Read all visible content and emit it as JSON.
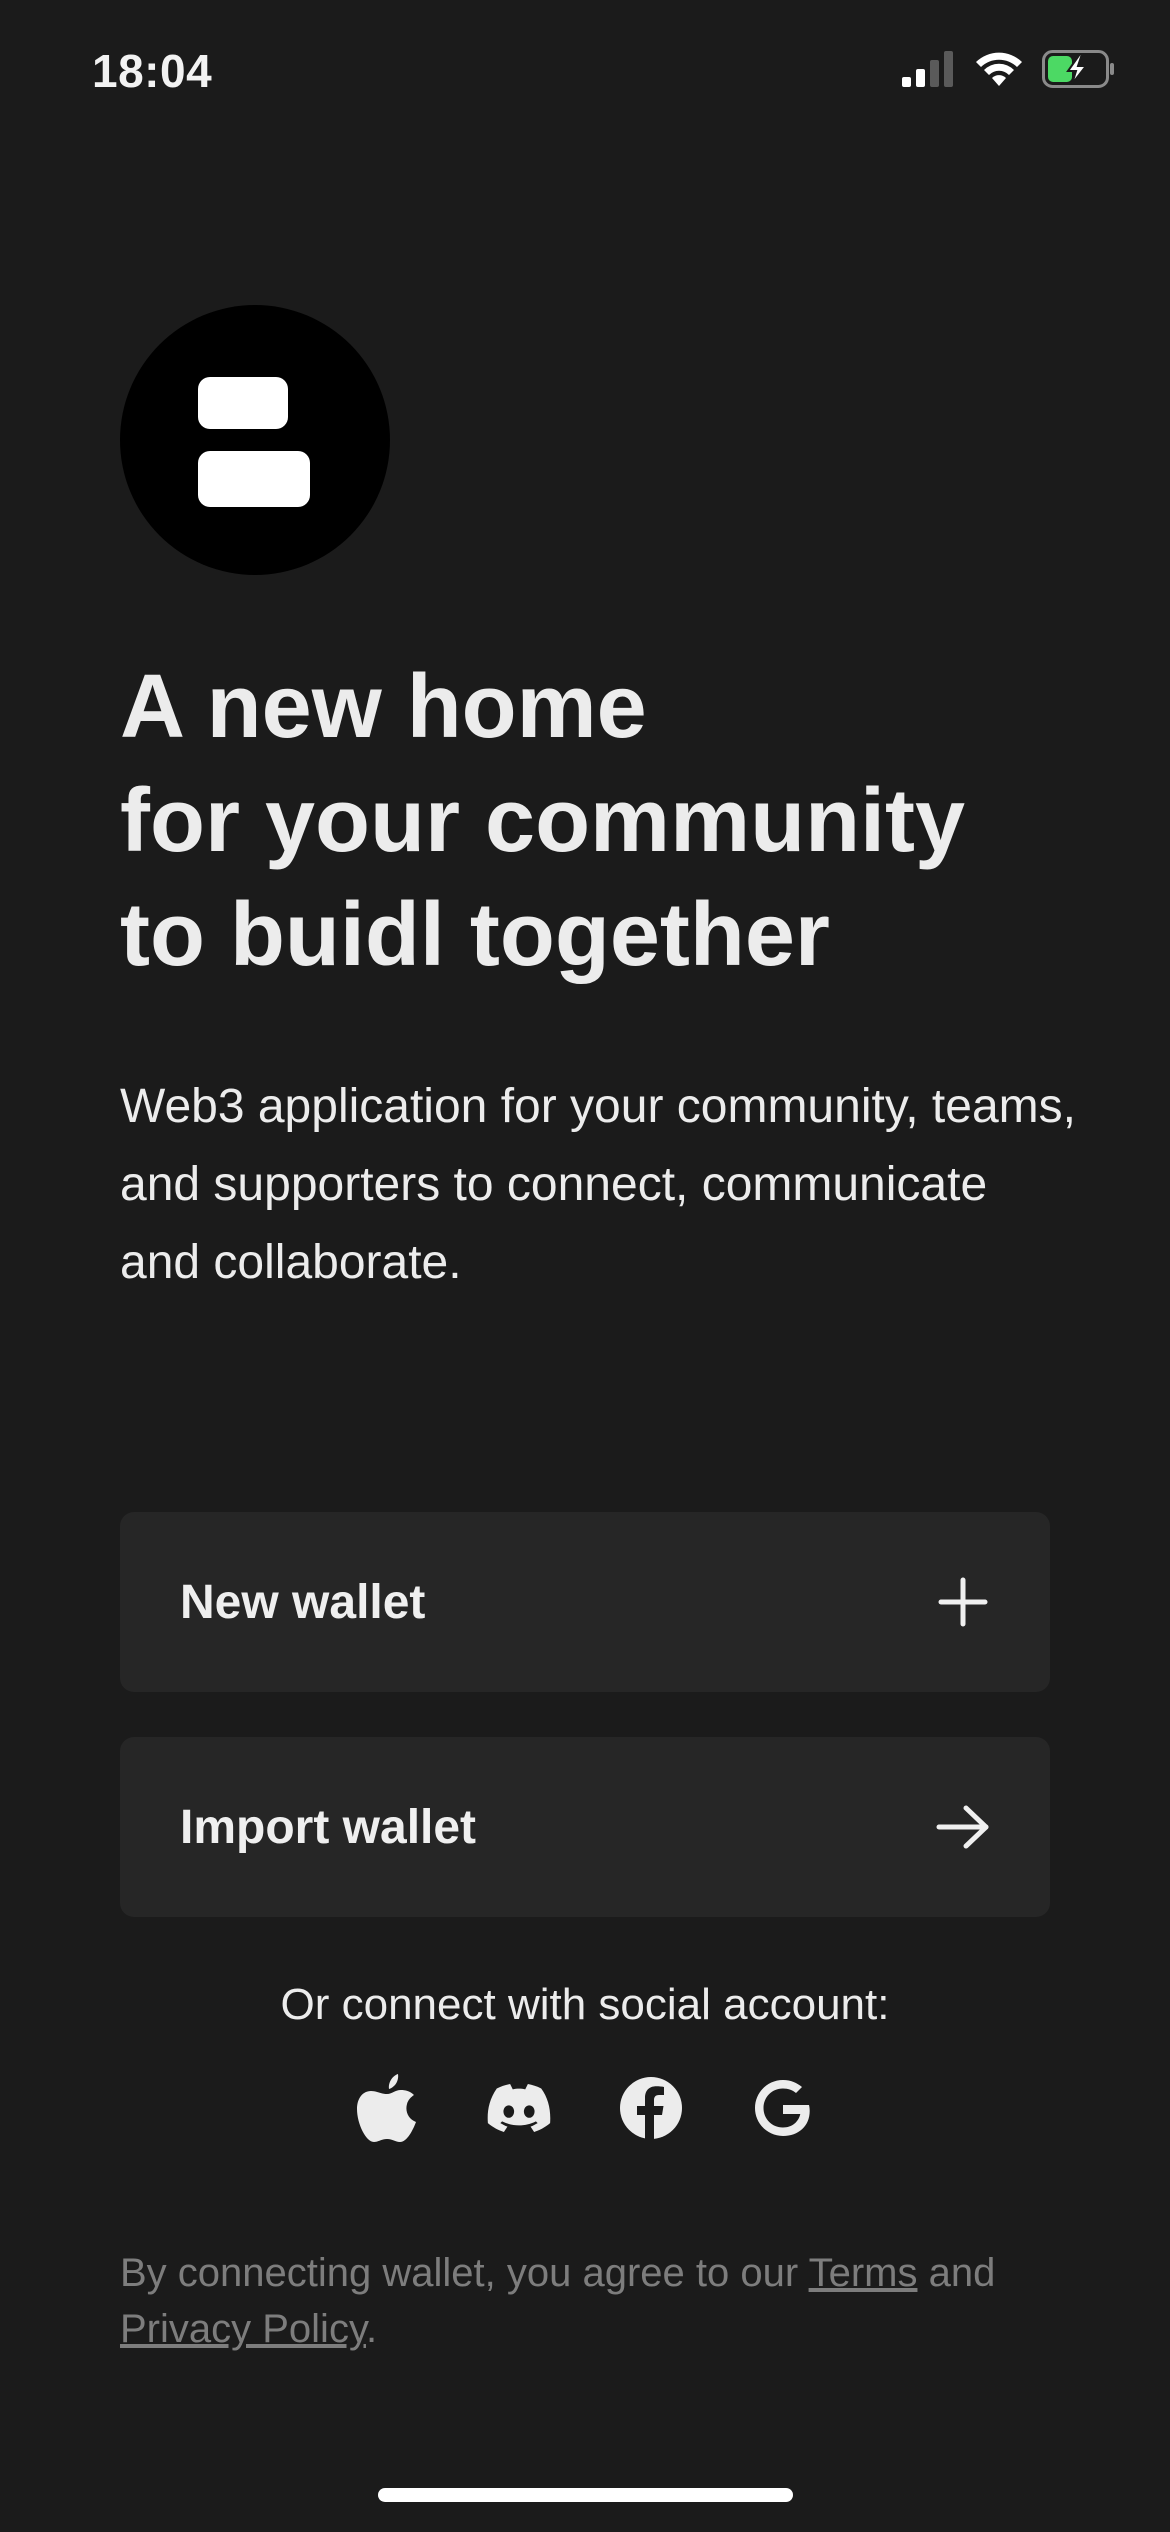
{
  "status_bar": {
    "time": "18:04",
    "icons": [
      "cellular-signal-icon",
      "wifi-icon",
      "battery-charging-icon"
    ]
  },
  "logo": {
    "icon": "app-logo-icon"
  },
  "headline": "A new home\nfor your community\nto buidl together",
  "description": "Web3 application for your community, teams, and supporters to connect, communicate and collaborate.",
  "actions": {
    "new_wallet": {
      "label": "New wallet",
      "icon": "plus-icon"
    },
    "import_wallet": {
      "label": "Import wallet",
      "icon": "arrow-right-icon"
    }
  },
  "social": {
    "caption": "Or connect with social account:",
    "providers": [
      "apple-icon",
      "discord-icon",
      "facebook-icon",
      "google-icon"
    ]
  },
  "legal": {
    "prefix": "By connecting wallet, you agree to our ",
    "terms_label": "Terms",
    "middle": " and",
    "privacy_label": "Privacy Policy",
    "suffix": "."
  },
  "colors": {
    "background": "#1b1b1b",
    "button_background": "#262626",
    "text_primary": "#ececec",
    "text_muted": "#7d7d7d",
    "battery_green": "#4cd964"
  }
}
